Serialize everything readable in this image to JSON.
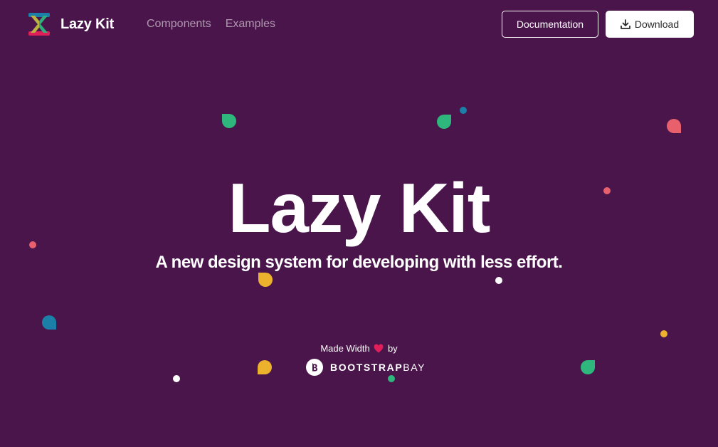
{
  "brand": {
    "name": "Lazy Kit",
    "logo_icon": "lazy-kit-logo-icon"
  },
  "nav": {
    "links": [
      {
        "label": "Components"
      },
      {
        "label": "Examples"
      }
    ]
  },
  "actions": {
    "documentation_label": "Documentation",
    "download_label": "Download",
    "download_icon": "download-icon"
  },
  "hero": {
    "title": "Lazy Kit",
    "subtitle": "A new design system for developing with less effort."
  },
  "credit": {
    "made_prefix": "Made Width",
    "heart_icon": "heart-icon",
    "made_suffix": "by",
    "partner_bold": "BOOTSTRAP",
    "partner_light": "BAY"
  },
  "colors": {
    "background": "#4a154b",
    "green": "#2eb67d",
    "blue": "#1b7fa8",
    "red": "#e8606c",
    "yellow": "#ecb22e",
    "heart": "#e01e5a"
  }
}
